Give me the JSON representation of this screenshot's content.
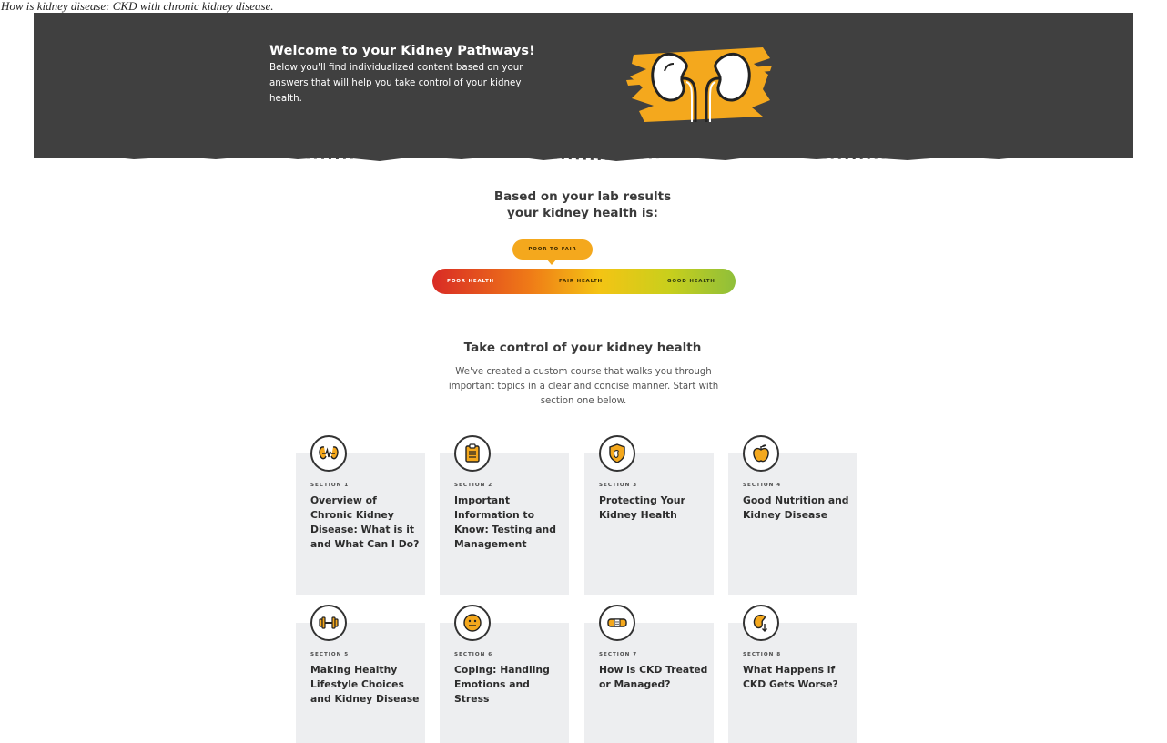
{
  "page": {
    "top_text": "How is kidney disease: CKD with chronic kidney disease."
  },
  "hero": {
    "title": "Welcome to your Kidney Pathways!",
    "body": "Below you'll find individualized content based on your answers that will help you take control of your kidney health.",
    "icon": "kidneys-icon",
    "colors": {
      "background": "#404040",
      "accent": "#f4a81d"
    }
  },
  "health_meter": {
    "heading_line1": "Based on your lab results",
    "heading_line2": "your kidney health is:",
    "current_label": "POOR TO FAIR",
    "scale": [
      "POOR HEALTH",
      "FAIR HEALTH",
      "GOOD HEALTH"
    ],
    "colors": {
      "poor": "#d92b25",
      "fair": "#f4c414",
      "good": "#8fbf3a",
      "pointer": "#f4a81d"
    }
  },
  "course": {
    "heading": "Take control of your kidney health",
    "body": "We've created a custom course that walks you through important topics in a clear and concise manner. Start with section one below."
  },
  "sections": [
    {
      "section": "SECTION 1",
      "title": "Overview of Chronic Kidney Disease: What is it and What Can I Do?",
      "icon": "kidney-pulse-icon"
    },
    {
      "section": "SECTION 2",
      "title": "Important Information to Know: Testing and Management",
      "icon": "clipboard-icon"
    },
    {
      "section": "SECTION 3",
      "title": "Protecting Your Kidney Health",
      "icon": "shield-icon"
    },
    {
      "section": "SECTION 4",
      "title": "Good Nutrition and Kidney Disease",
      "icon": "apple-icon"
    },
    {
      "section": "SECTION 5",
      "title": "Making Healthy Lifestyle Choices and Kidney Disease",
      "icon": "dumbbell-icon"
    },
    {
      "section": "SECTION 6",
      "title": "Coping: Handling Emotions and Stress",
      "icon": "face-icon"
    },
    {
      "section": "SECTION 7",
      "title": "How is CKD Treated or Managed?",
      "icon": "bandage-icon"
    },
    {
      "section": "SECTION 8",
      "title": "What Happens if CKD Gets Worse?",
      "icon": "kidney-down-icon"
    }
  ]
}
